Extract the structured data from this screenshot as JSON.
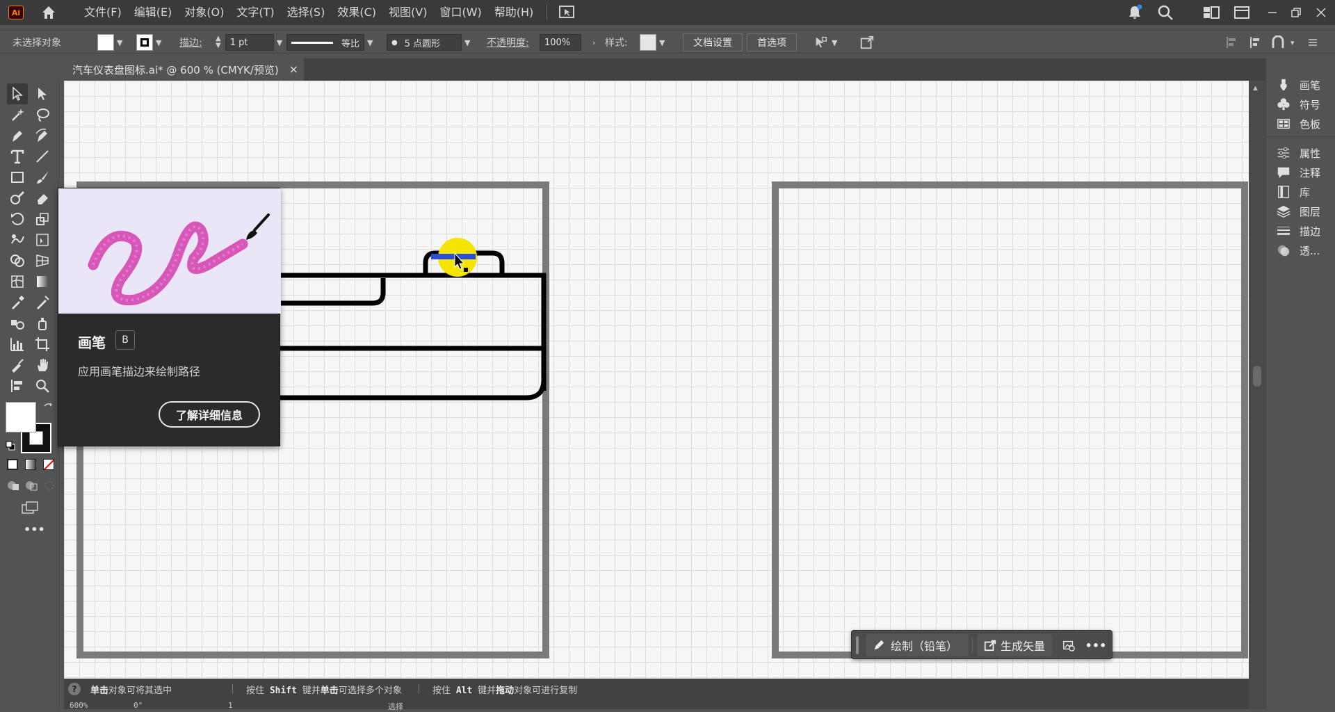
{
  "app": {
    "logo": "Ai"
  },
  "menu": [
    "文件(F)",
    "编辑(E)",
    "对象(O)",
    "文字(T)",
    "选择(S)",
    "效果(C)",
    "视图(V)",
    "窗口(W)",
    "帮助(H)"
  ],
  "control": {
    "selection": "未选择对象",
    "stroke_label": "描边:",
    "stroke_value": "1 pt",
    "profile": "等比",
    "brush": "5 点圆形",
    "opacity_label": "不透明度:",
    "opacity_value": "100%",
    "style_label": "样式:",
    "doc_setup": "文档设置",
    "prefs": "首选项"
  },
  "tab": {
    "title": "汽车仪表盘图标.ai* @ 600 % (CMYK/预览)",
    "close": "×"
  },
  "panels": [
    "画笔",
    "符号",
    "色板",
    "属性",
    "注释",
    "库",
    "图层",
    "描边",
    "透..."
  ],
  "tooltip": {
    "title": "画笔",
    "shortcut": "B",
    "description": "应用画笔描边来绘制路径",
    "learn_more": "了解详细信息"
  },
  "taskbar": {
    "draw": "绘制（铅笔）",
    "generate": "生成矢量",
    "more": "•••"
  },
  "status": {
    "hint1_bold": "单击",
    "hint1": "对象可将其选中",
    "hint2_a": "按住 ",
    "hint2_bold": "Shift",
    "hint2_b": " 键并",
    "hint2_bold2": "单击",
    "hint2_c": "可选择多个对象",
    "hint3_a": "按住 ",
    "hint3_bold": "Alt",
    "hint3_b": " 键并",
    "hint3_bold2": "拖动",
    "hint3_c": "对象可进行复制",
    "zoom": "600%",
    "rotate": "0°",
    "page": "1",
    "mode": "选择"
  },
  "colors": {
    "accent": "#ff7c00",
    "highlight": "#f5e400",
    "brush_stroke": "#d657b8",
    "selection": "#2a4fd6"
  }
}
